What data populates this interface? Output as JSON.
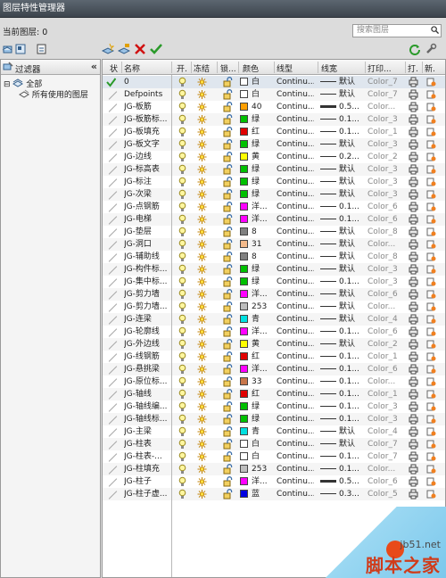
{
  "window": {
    "title": "图层特性管理器"
  },
  "current_layer": {
    "label": "当前图层: 0"
  },
  "search": {
    "placeholder": "搜索图层"
  },
  "filter": {
    "header": "过滤器",
    "collapse": "«",
    "tree": [
      {
        "expander": "⊟",
        "label": "全部"
      },
      {
        "expander": "",
        "label": "所有使用的图层"
      }
    ]
  },
  "columns": [
    "状",
    "名称",
    "开.",
    "冻结",
    "锁...",
    "颜色",
    "线型",
    "线宽",
    "打印...",
    "打.",
    "新."
  ],
  "layers": [
    {
      "name": "0",
      "color": "白",
      "swatch": "#ffffff",
      "linetype": "Continu...",
      "lineweight": "默认",
      "plot_style": "Color_7",
      "current": true,
      "thick": false
    },
    {
      "name": "Defpoints",
      "color": "白",
      "swatch": "#ffffff",
      "linetype": "Continu...",
      "lineweight": "默认",
      "plot_style": "Color_7",
      "current": false,
      "thick": false
    },
    {
      "name": "JG-板筋",
      "color": "40",
      "swatch": "#ff9f00",
      "linetype": "Continu...",
      "lineweight": "0.5...",
      "plot_style": "Color...",
      "current": false,
      "thick": true
    },
    {
      "name": "JG-板筋标...",
      "color": "绿",
      "swatch": "#00c000",
      "linetype": "Continu...",
      "lineweight": "0.1...",
      "plot_style": "Color_3",
      "current": false,
      "thick": false
    },
    {
      "name": "JG-板填充",
      "color": "红",
      "swatch": "#e00000",
      "linetype": "Continu...",
      "lineweight": "0.1...",
      "plot_style": "Color_1",
      "current": false,
      "thick": false
    },
    {
      "name": "JG-板文字",
      "color": "绿",
      "swatch": "#00c000",
      "linetype": "Continu...",
      "lineweight": "默认",
      "plot_style": "Color_3",
      "current": false,
      "thick": false
    },
    {
      "name": "JG-边线",
      "color": "黄",
      "swatch": "#ffff00",
      "linetype": "Continu...",
      "lineweight": "0.2...",
      "plot_style": "Color_2",
      "current": false,
      "thick": false
    },
    {
      "name": "JG-标高表",
      "color": "绿",
      "swatch": "#00c000",
      "linetype": "Continu...",
      "lineweight": "默认",
      "plot_style": "Color_3",
      "current": false,
      "thick": false
    },
    {
      "name": "JG-标注",
      "color": "绿",
      "swatch": "#00c000",
      "linetype": "Continu...",
      "lineweight": "默认",
      "plot_style": "Color_3",
      "current": false,
      "thick": false
    },
    {
      "name": "JG-次梁",
      "color": "绿",
      "swatch": "#00c000",
      "linetype": "Continu...",
      "lineweight": "默认",
      "plot_style": "Color_3",
      "current": false,
      "thick": false
    },
    {
      "name": "JG-点钢筋",
      "color": "洋...",
      "swatch": "#ff00ff",
      "linetype": "Continu...",
      "lineweight": "0.1...",
      "plot_style": "Color_6",
      "current": false,
      "thick": false
    },
    {
      "name": "JG-电梯",
      "color": "洋...",
      "swatch": "#ff00ff",
      "linetype": "Continu...",
      "lineweight": "0.1...",
      "plot_style": "Color_6",
      "current": false,
      "thick": false
    },
    {
      "name": "JG-垫层",
      "color": "8",
      "swatch": "#808080",
      "linetype": "Continu...",
      "lineweight": "默认",
      "plot_style": "Color_8",
      "current": false,
      "thick": false
    },
    {
      "name": "JG-洞口",
      "color": "31",
      "swatch": "#f2b98a",
      "linetype": "Continu...",
      "lineweight": "默认",
      "plot_style": "Color...",
      "current": false,
      "thick": false
    },
    {
      "name": "JG-辅助线",
      "color": "8",
      "swatch": "#808080",
      "linetype": "Continu...",
      "lineweight": "默认",
      "plot_style": "Color_8",
      "current": false,
      "thick": false
    },
    {
      "name": "JG-构件标...",
      "color": "绿",
      "swatch": "#00c000",
      "linetype": "Continu...",
      "lineweight": "默认",
      "plot_style": "Color_3",
      "current": false,
      "thick": false
    },
    {
      "name": "JG-集中标...",
      "color": "绿",
      "swatch": "#00c000",
      "linetype": "Continu...",
      "lineweight": "0.1...",
      "plot_style": "Color_3",
      "current": false,
      "thick": false
    },
    {
      "name": "JG-剪力墙",
      "color": "洋...",
      "swatch": "#ff00ff",
      "linetype": "Continu...",
      "lineweight": "默认",
      "plot_style": "Color_6",
      "current": false,
      "thick": false
    },
    {
      "name": "JG-剪力墙...",
      "color": "253",
      "swatch": "#bdbdbd",
      "linetype": "Continu...",
      "lineweight": "默认",
      "plot_style": "Color...",
      "current": false,
      "thick": false
    },
    {
      "name": "JG-连梁",
      "color": "青",
      "swatch": "#00e0e0",
      "linetype": "Continu...",
      "lineweight": "默认",
      "plot_style": "Color_4",
      "current": false,
      "thick": false
    },
    {
      "name": "JG-轮廓线",
      "color": "洋...",
      "swatch": "#ff00ff",
      "linetype": "Continu...",
      "lineweight": "0.1...",
      "plot_style": "Color_6",
      "current": false,
      "thick": false
    },
    {
      "name": "JG-外边线",
      "color": "黄",
      "swatch": "#ffff00",
      "linetype": "Continu...",
      "lineweight": "默认",
      "plot_style": "Color_2",
      "current": false,
      "thick": false
    },
    {
      "name": "JG-线钢筋",
      "color": "红",
      "swatch": "#e00000",
      "linetype": "Continu...",
      "lineweight": "0.1...",
      "plot_style": "Color_1",
      "current": false,
      "thick": false
    },
    {
      "name": "JG-悬挑梁",
      "color": "洋...",
      "swatch": "#ff00ff",
      "linetype": "Continu...",
      "lineweight": "0.1...",
      "plot_style": "Color_6",
      "current": false,
      "thick": false
    },
    {
      "name": "JG-原位标...",
      "color": "33",
      "swatch": "#c8764a",
      "linetype": "Continu...",
      "lineweight": "0.1...",
      "plot_style": "Color...",
      "current": false,
      "thick": false
    },
    {
      "name": "JG-轴线",
      "color": "红",
      "swatch": "#e00000",
      "linetype": "Continu...",
      "lineweight": "0.1...",
      "plot_style": "Color_1",
      "current": false,
      "thick": false
    },
    {
      "name": "JG-轴线编...",
      "color": "绿",
      "swatch": "#00c000",
      "linetype": "Continu...",
      "lineweight": "0.1...",
      "plot_style": "Color_3",
      "current": false,
      "thick": false
    },
    {
      "name": "JG-轴线标...",
      "color": "绿",
      "swatch": "#00c000",
      "linetype": "Continu...",
      "lineweight": "0.1...",
      "plot_style": "Color_3",
      "current": false,
      "thick": false
    },
    {
      "name": "JG-主梁",
      "color": "青",
      "swatch": "#00e0e0",
      "linetype": "Continu...",
      "lineweight": "默认",
      "plot_style": "Color_4",
      "current": false,
      "thick": false
    },
    {
      "name": "JG-柱表",
      "color": "白",
      "swatch": "#ffffff",
      "linetype": "Continu...",
      "lineweight": "默认",
      "plot_style": "Color_7",
      "current": false,
      "thick": false
    },
    {
      "name": "JG-柱表-...",
      "color": "白",
      "swatch": "#ffffff",
      "linetype": "Continu...",
      "lineweight": "0.1...",
      "plot_style": "Color_7",
      "current": false,
      "thick": false
    },
    {
      "name": "JG-柱填充",
      "color": "253",
      "swatch": "#bdbdbd",
      "linetype": "Continu...",
      "lineweight": "0.1...",
      "plot_style": "Color...",
      "current": false,
      "thick": false
    },
    {
      "name": "JG-柱子",
      "color": "洋...",
      "swatch": "#ff00ff",
      "linetype": "Continu...",
      "lineweight": "0.5...",
      "plot_style": "Color_6",
      "current": false,
      "thick": true
    },
    {
      "name": "JG-柱子虚...",
      "color": "蓝",
      "swatch": "#0000e0",
      "linetype": "Continu...",
      "lineweight": "0.3...",
      "plot_style": "Color_5",
      "current": false,
      "thick": false
    }
  ],
  "watermark": {
    "site": "jb51.net",
    "brand": "脚本之家"
  }
}
